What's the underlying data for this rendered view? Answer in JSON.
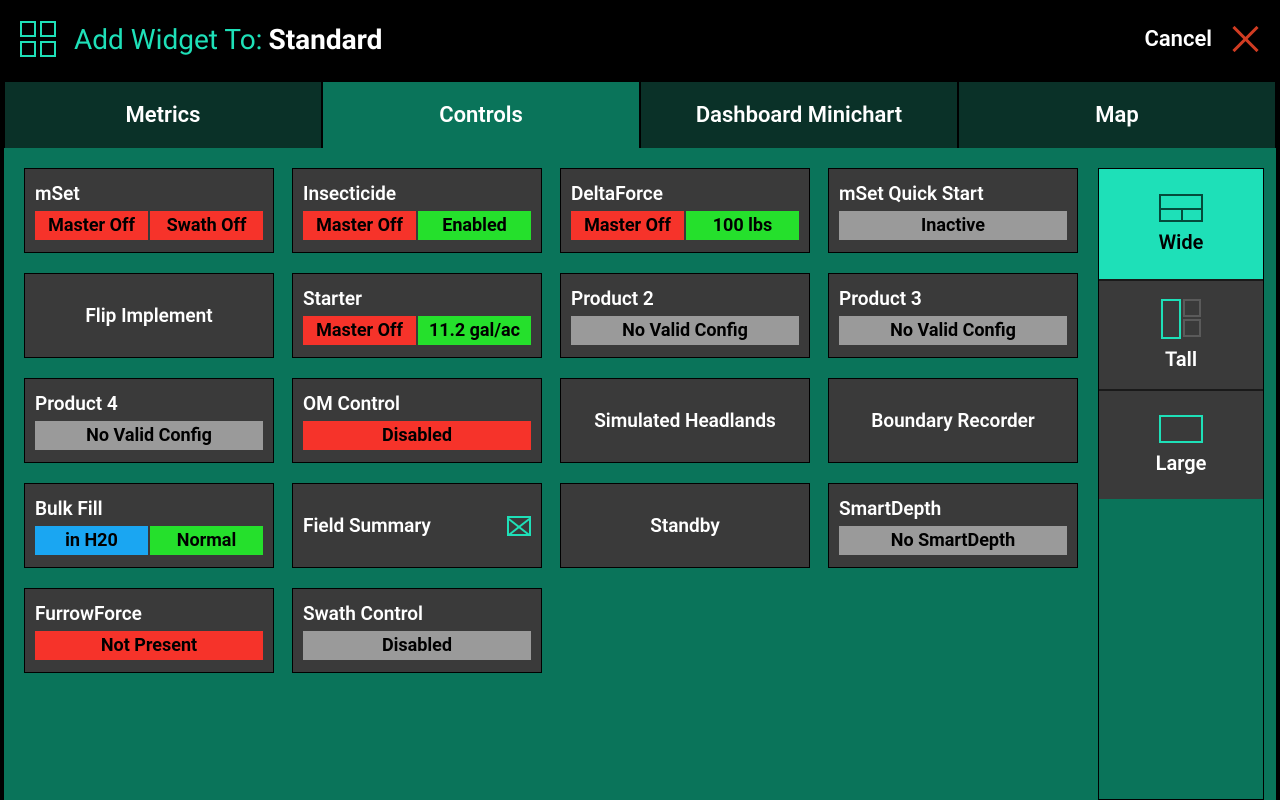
{
  "header": {
    "title_prefix": "Add Widget To:",
    "destination": "Standard",
    "cancel": "Cancel"
  },
  "tabs": [
    {
      "label": "Metrics",
      "active": false
    },
    {
      "label": "Controls",
      "active": true
    },
    {
      "label": "Dashboard Minichart",
      "active": false
    },
    {
      "label": "Map",
      "active": false
    }
  ],
  "sizes": [
    {
      "name": "Wide",
      "active": true
    },
    {
      "name": "Tall",
      "active": false
    },
    {
      "name": "Large",
      "active": false
    }
  ],
  "widgets": {
    "mset": {
      "title": "mSet",
      "b1": "Master Off",
      "b2": "Swath Off"
    },
    "insecticide": {
      "title": "Insecticide",
      "b1": "Master Off",
      "b2": "Enabled"
    },
    "deltaforce": {
      "title": "DeltaForce",
      "b1": "Master Off",
      "b2": "100 lbs"
    },
    "mset_quick": {
      "title": "mSet Quick Start",
      "s": "Inactive"
    },
    "flip": {
      "title": "Flip Implement"
    },
    "starter": {
      "title": "Starter",
      "b1": "Master Off",
      "b2": "11.2 gal/ac"
    },
    "product2": {
      "title": "Product 2",
      "s": "No Valid Config"
    },
    "product3": {
      "title": "Product 3",
      "s": "No Valid Config"
    },
    "product4": {
      "title": "Product 4",
      "s": "No Valid Config"
    },
    "omcontrol": {
      "title": "OM Control",
      "s": "Disabled"
    },
    "simheadlands": {
      "title": "Simulated Headlands"
    },
    "boundary": {
      "title": "Boundary Recorder"
    },
    "bulkfill": {
      "title": "Bulk Fill",
      "b1": "in H20",
      "b2": "Normal"
    },
    "fieldsummary": {
      "title": "Field Summary"
    },
    "standby": {
      "title": "Standby"
    },
    "smartdepth": {
      "title": "SmartDepth",
      "s": "No SmartDepth"
    },
    "furrowforce": {
      "title": "FurrowForce",
      "s": "Not Present"
    },
    "swathcontrol": {
      "title": "Swath Control",
      "s": "Disabled"
    }
  }
}
